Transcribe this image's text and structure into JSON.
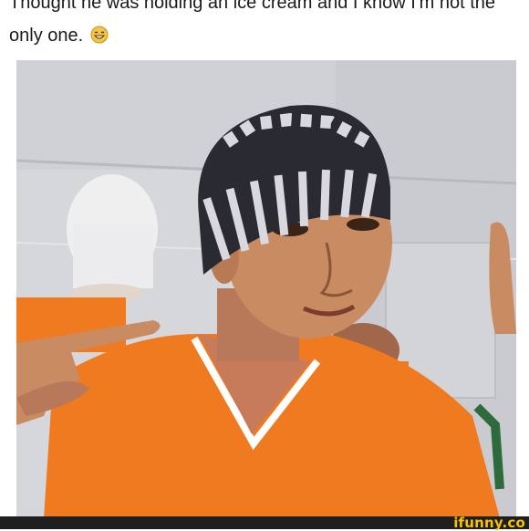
{
  "caption": {
    "line1": "Thought he was holding an ice cream and I know I'm not the",
    "line2": "only one.",
    "emoji": "grinning-sweat-emoji"
  },
  "photo": {
    "subject": "teen-in-orange-shirt-and-striped-beanie",
    "colors": {
      "shirt": "#f07a1f",
      "beanie_dark": "#2a2a33",
      "beanie_light": "#d8d8de",
      "wall": "#dcdde0",
      "skin": "#c98b62"
    }
  },
  "watermark": {
    "text": "ifunny.co",
    "color": "#f7c200"
  }
}
